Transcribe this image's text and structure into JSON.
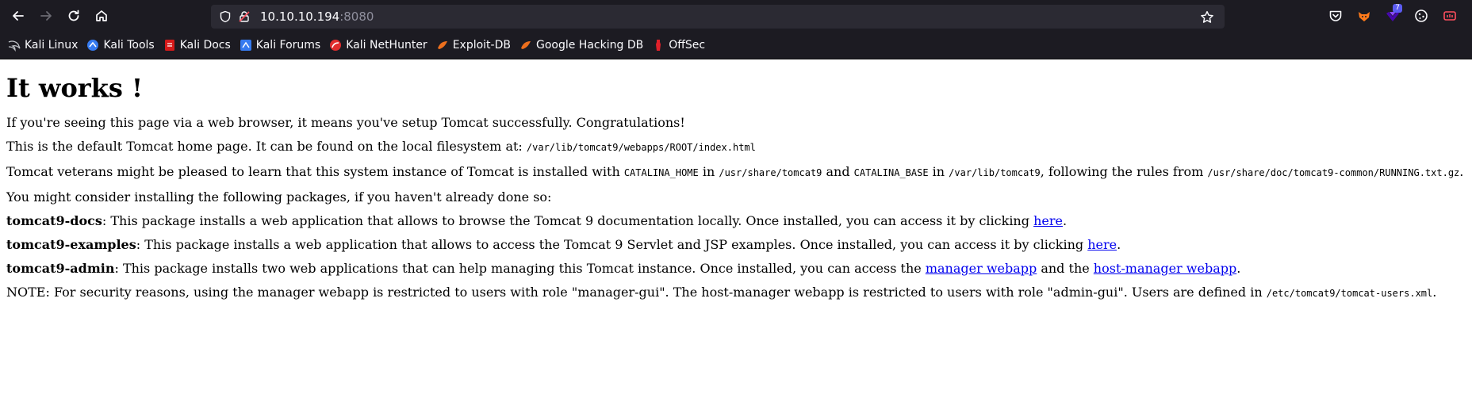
{
  "browser": {
    "url_host": "10.10.10.194",
    "url_port": ":8080",
    "extension_badge": "7"
  },
  "bookmarks": [
    {
      "label": "Kali Linux",
      "icon": "kali-dragon-icon"
    },
    {
      "label": "Kali Tools",
      "icon": "kali-tools-icon"
    },
    {
      "label": "Kali Docs",
      "icon": "kali-docs-icon"
    },
    {
      "label": "Kali Forums",
      "icon": "kali-forums-icon"
    },
    {
      "label": "Kali NetHunter",
      "icon": "nethunter-icon"
    },
    {
      "label": "Exploit-DB",
      "icon": "exploit-db-icon"
    },
    {
      "label": "Google Hacking DB",
      "icon": "ghdb-icon"
    },
    {
      "label": "OffSec",
      "icon": "offsec-icon"
    }
  ],
  "page": {
    "title": "It works !",
    "p1": "If you're seeing this page via a web browser, it means you've setup Tomcat successfully. Congratulations!",
    "p2_text": "This is the default Tomcat home page. It can be found on the local filesystem at: ",
    "p2_code": "/var/lib/tomcat9/webapps/ROOT/index.html",
    "p3_a": "Tomcat veterans might be pleased to learn that this system instance of Tomcat is installed with ",
    "p3_code1": "CATALINA_HOME",
    "p3_b": " in ",
    "p3_code2": "/usr/share/tomcat9",
    "p3_c": " and ",
    "p3_code3": "CATALINA_BASE",
    "p3_d": " in ",
    "p3_code4": "/var/lib/tomcat9",
    "p3_e": ", following the rules from ",
    "p3_code5": "/usr/share/doc/tomcat9-common/RUNNING.txt.gz",
    "p3_f": ".",
    "p4": "You might consider installing the following packages, if you haven't already done so:",
    "docs_name": "tomcat9-docs",
    "docs_text": ": This package installs a web application that allows to browse the Tomcat 9 documentation locally. Once installed, you can access it by clicking ",
    "docs_link": "here",
    "examples_name": "tomcat9-examples",
    "examples_text": ": This package installs a web application that allows to access the Tomcat 9 Servlet and JSP examples. Once installed, you can access it by clicking ",
    "examples_link": "here",
    "admin_name": "tomcat9-admin",
    "admin_text": ": This package installs two web applications that can help managing this Tomcat instance. Once installed, you can access the ",
    "admin_link1": "manager webapp",
    "admin_mid": " and the ",
    "admin_link2": "host-manager webapp",
    "period": ".",
    "note_text": "NOTE: For security reasons, using the manager webapp is restricted to users with role \"manager-gui\". The host-manager webapp is restricted to users with role \"admin-gui\". Users are defined in ",
    "note_code": "/etc/tomcat9/tomcat-users.xml"
  }
}
